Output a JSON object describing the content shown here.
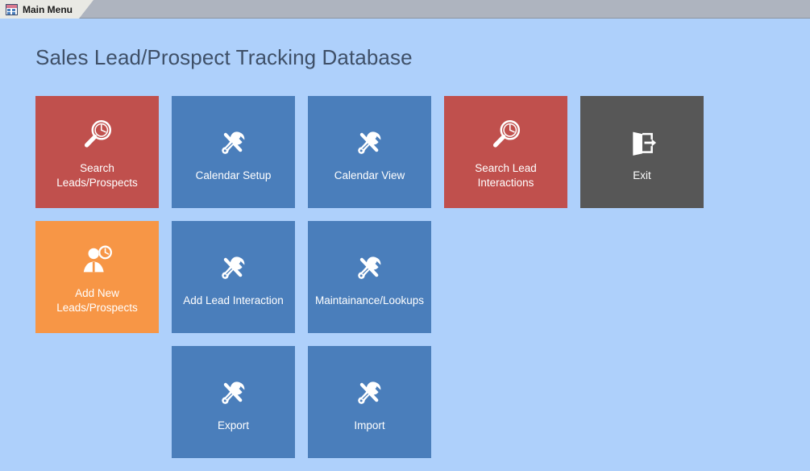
{
  "window": {
    "tab": {
      "label": "Main Menu",
      "icon": "access-form-icon"
    }
  },
  "form": {
    "title": "Sales Lead/Prospect Tracking Database",
    "background_color": "#aed0fb",
    "title_color": "#3f5068"
  },
  "colors": {
    "red": "#c0504d",
    "blue": "#4a7ebb",
    "orange": "#f79646",
    "dark_gray": "#575757",
    "tabstrip": "#aeb4bf",
    "tab_active": "#e9e9e4"
  },
  "tiles": [
    [
      {
        "label": "Search Leads/Prospects",
        "icon": "magnifier-clock-icon",
        "color": "#c0504d"
      },
      {
        "label": "Calendar Setup",
        "icon": "screwdriver-wrench-icon",
        "color": "#4a7ebb"
      },
      {
        "label": "Calendar View",
        "icon": "screwdriver-wrench-icon",
        "color": "#4a7ebb"
      },
      {
        "label": "Search Lead Interactions",
        "icon": "magnifier-clock-icon",
        "color": "#c0504d"
      },
      {
        "label": "Exit",
        "icon": "exit-door-icon",
        "color": "#575757"
      }
    ],
    [
      {
        "label": "Add New Leads/Prospects",
        "icon": "person-clock-icon",
        "color": "#f79646"
      },
      {
        "label": "Add Lead Interaction",
        "icon": "screwdriver-wrench-icon",
        "color": "#4a7ebb"
      },
      {
        "label": "Maintainance/Lookups",
        "icon": "screwdriver-wrench-icon",
        "color": "#4a7ebb"
      },
      {
        "label": "",
        "icon": "none",
        "color": "transparent"
      },
      {
        "label": "",
        "icon": "none",
        "color": "transparent"
      }
    ],
    [
      {
        "label": "",
        "icon": "none",
        "color": "transparent"
      },
      {
        "label": "Export",
        "icon": "screwdriver-wrench-icon",
        "color": "#4a7ebb"
      },
      {
        "label": "Import",
        "icon": "screwdriver-wrench-icon",
        "color": "#4a7ebb"
      },
      {
        "label": "",
        "icon": "none",
        "color": "transparent"
      },
      {
        "label": "",
        "icon": "none",
        "color": "transparent"
      }
    ]
  ]
}
